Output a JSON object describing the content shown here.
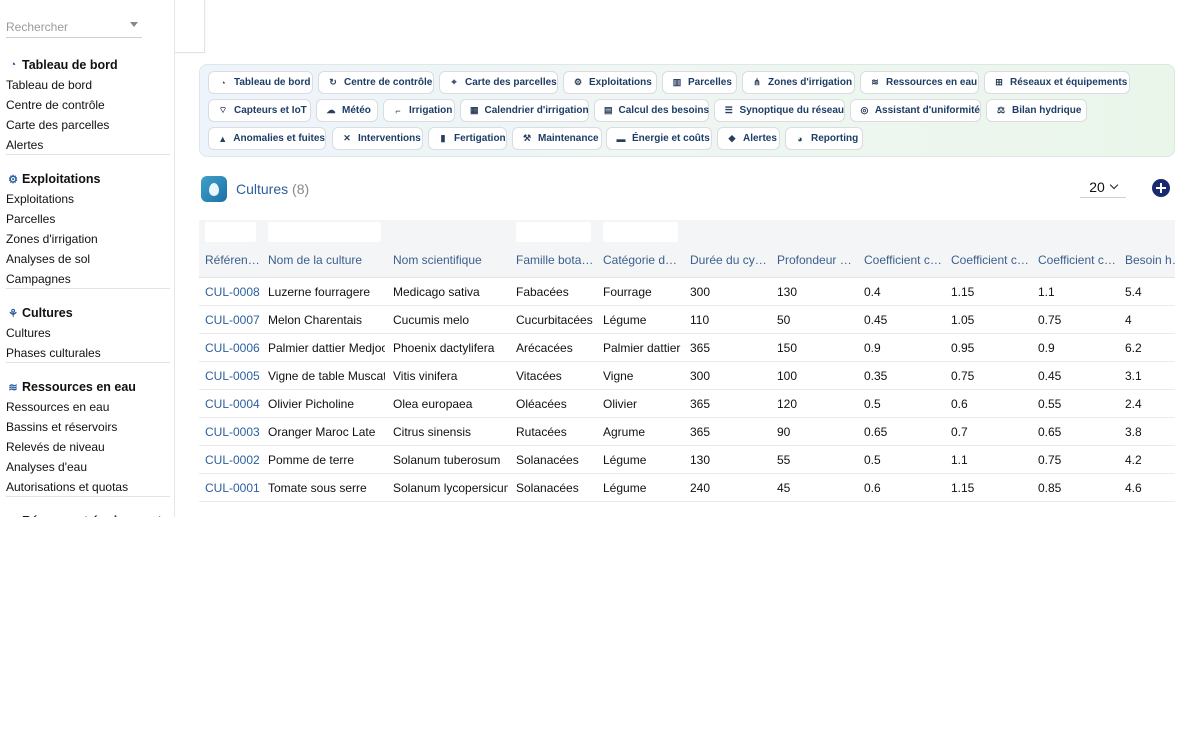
{
  "search": {
    "placeholder": "Rechercher"
  },
  "sidebar": {
    "sections": [
      {
        "title": "Tableau de bord",
        "icon": "gauge-icon",
        "items": [
          "Tableau de bord",
          "Centre de contrôle",
          "Carte des parcelles",
          "Alertes"
        ]
      },
      {
        "title": "Exploitations",
        "icon": "tractor-icon",
        "items": [
          "Exploitations",
          "Parcelles",
          "Zones d'irrigation",
          "Analyses de sol",
          "Campagnes"
        ]
      },
      {
        "title": "Cultures",
        "icon": "seedling-icon",
        "items": [
          "Cultures",
          "Phases culturales"
        ]
      },
      {
        "title": "Ressources en eau",
        "icon": "water-icon",
        "items": [
          "Ressources en eau",
          "Bassins et réservoirs",
          "Relevés de niveau",
          "Analyses d'eau",
          "Autorisations et quotas"
        ]
      },
      {
        "title": "Réseaux et équipements",
        "icon": "network-icon",
        "items": []
      }
    ]
  },
  "modules": [
    {
      "label": "Tableau de bord",
      "icon": "gauge-icon"
    },
    {
      "label": "Centre de contrôle",
      "icon": "refresh-icon"
    },
    {
      "label": "Carte des parcelles",
      "icon": "map-marker-icon"
    },
    {
      "label": "Exploitations",
      "icon": "tractor-icon"
    },
    {
      "label": "Parcelles",
      "icon": "map-icon"
    },
    {
      "label": "Zones d'irrigation",
      "icon": "sitemap-icon"
    },
    {
      "label": "Ressources en eau",
      "icon": "water-icon"
    },
    {
      "label": "Réseaux et équipements",
      "icon": "network-icon"
    },
    {
      "label": "Capteurs et IoT",
      "icon": "broadcast-icon"
    },
    {
      "label": "Météo",
      "icon": "cloud-icon"
    },
    {
      "label": "Irrigation",
      "icon": "faucet-icon"
    },
    {
      "label": "Calendrier d'irrigation",
      "icon": "calendar-icon"
    },
    {
      "label": "Calcul des besoins",
      "icon": "calculator-icon"
    },
    {
      "label": "Synoptique du réseau",
      "icon": "list-icon"
    },
    {
      "label": "Assistant d'uniformité",
      "icon": "target-icon"
    },
    {
      "label": "Bilan hydrique",
      "icon": "balance-icon"
    },
    {
      "label": "Anomalies et fuites",
      "icon": "warning-icon"
    },
    {
      "label": "Interventions",
      "icon": "tools-icon"
    },
    {
      "label": "Fertigation",
      "icon": "flask-icon"
    },
    {
      "label": "Maintenance",
      "icon": "wrench-icon"
    },
    {
      "label": "Énergie et coûts",
      "icon": "money-icon"
    },
    {
      "label": "Alertes",
      "icon": "bell-icon"
    },
    {
      "label": "Reporting",
      "icon": "chart-pie-icon"
    }
  ],
  "page": {
    "title": "Cultures",
    "count": "(8)",
    "page_size": "20"
  },
  "table": {
    "headers": [
      "Référence",
      "Nom de la culture",
      "Nom scientifique",
      "Famille botanique",
      "Catégorie de culture",
      "Durée du cycle",
      "Profondeur racinaire",
      "Coefficient cultural initial",
      "Coefficient cultural mi-saison",
      "Coefficient cultural fin",
      "Besoin hydrique"
    ],
    "rows": [
      [
        "CUL-0008",
        "Luzerne fourragere",
        "Medicago sativa",
        "Fabacées",
        "Fourrage",
        "300",
        "130",
        "0.4",
        "1.15",
        "1.1",
        "5.4"
      ],
      [
        "CUL-0007",
        "Melon Charentais",
        "Cucumis melo",
        "Cucurbitacées",
        "Légume",
        "110",
        "50",
        "0.45",
        "1.05",
        "0.75",
        "4"
      ],
      [
        "CUL-0006",
        "Palmier dattier Medjool",
        "Phoenix dactylifera",
        "Arécacées",
        "Palmier dattier",
        "365",
        "150",
        "0.9",
        "0.95",
        "0.9",
        "6.2"
      ],
      [
        "CUL-0005",
        "Vigne de table Muscat",
        "Vitis vinifera",
        "Vitacées",
        "Vigne",
        "300",
        "100",
        "0.35",
        "0.75",
        "0.45",
        "3.1"
      ],
      [
        "CUL-0004",
        "Olivier Picholine",
        "Olea europaea",
        "Oléacées",
        "Olivier",
        "365",
        "120",
        "0.5",
        "0.6",
        "0.55",
        "2.4"
      ],
      [
        "CUL-0003",
        "Oranger Maroc Late",
        "Citrus sinensis",
        "Rutacées",
        "Agrume",
        "365",
        "90",
        "0.65",
        "0.7",
        "0.65",
        "3.8"
      ],
      [
        "CUL-0002",
        "Pomme de terre",
        "Solanum tuberosum",
        "Solanacées",
        "Légume",
        "130",
        "55",
        "0.5",
        "1.1",
        "0.75",
        "4.2"
      ],
      [
        "CUL-0001",
        "Tomate sous serre",
        "Solanum lycopersicum",
        "Solanacées",
        "Légume",
        "240",
        "45",
        "0.6",
        "1.15",
        "0.85",
        "4.6"
      ]
    ]
  }
}
